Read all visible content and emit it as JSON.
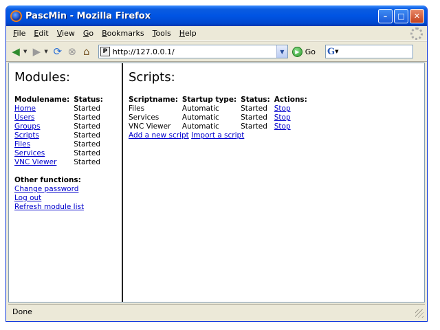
{
  "window": {
    "title": "PascMin - Mozilla Firefox"
  },
  "menu": [
    {
      "label": "File",
      "u": "F",
      "rest": "ile"
    },
    {
      "label": "Edit",
      "u": "E",
      "rest": "dit"
    },
    {
      "label": "View",
      "u": "V",
      "rest": "iew"
    },
    {
      "label": "Go",
      "u": "G",
      "rest": "o"
    },
    {
      "label": "Bookmarks",
      "u": "B",
      "rest": "ookmarks"
    },
    {
      "label": "Tools",
      "u": "T",
      "rest": "ools"
    },
    {
      "label": "Help",
      "u": "H",
      "rest": "elp"
    }
  ],
  "nav": {
    "url": "http://127.0.0.1/",
    "go_label": "Go",
    "search_logo": "G"
  },
  "modules": {
    "heading": "Modules:",
    "col_name": "Modulename:",
    "col_status": "Status:",
    "rows": [
      {
        "name": "Home",
        "status": "Started"
      },
      {
        "name": "Users",
        "status": "Started"
      },
      {
        "name": "Groups",
        "status": "Started"
      },
      {
        "name": "Scripts",
        "status": "Started"
      },
      {
        "name": "Files",
        "status": "Started"
      },
      {
        "name": "Services",
        "status": "Started"
      },
      {
        "name": "VNC Viewer",
        "status": "Started"
      }
    ],
    "other_title": "Other functions:",
    "other_links": [
      "Change password",
      "Log out",
      "Refresh module list"
    ]
  },
  "scripts": {
    "heading": "Scripts:",
    "columns": [
      "Scriptname:",
      "Startup type:",
      "Status:",
      "Actions:"
    ],
    "rows": [
      {
        "name": "Files",
        "startup": "Automatic",
        "status": "Started",
        "action": "Stop"
      },
      {
        "name": "Services",
        "startup": "Automatic",
        "status": "Started",
        "action": "Stop"
      },
      {
        "name": "VNC Viewer",
        "startup": "Automatic",
        "status": "Started",
        "action": "Stop"
      }
    ],
    "add_link": "Add a new script",
    "import_link": "Import a script"
  },
  "status": {
    "text": "Done"
  }
}
